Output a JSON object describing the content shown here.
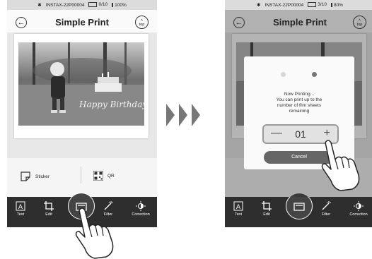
{
  "left": {
    "status": {
      "device": "INSTAX-22P00004",
      "prints": "0/10",
      "battery": "100%"
    },
    "title": "Simple Print",
    "top_label": "top",
    "photo_caption": "Happy Birthday",
    "options": [
      {
        "label": "Sticker"
      },
      {
        "label": "QR"
      }
    ],
    "tools": [
      {
        "label": "Text"
      },
      {
        "label": "Edit"
      },
      {
        "label": "Filter"
      },
      {
        "label": "Correction"
      }
    ]
  },
  "right": {
    "status": {
      "device": "INSTAX-22P00004",
      "prints": "3/10",
      "battery": "80%"
    },
    "title": "Simple Print",
    "top_label": "top",
    "dialog": {
      "line1": "Now Printing...",
      "line2": "You can print up to the",
      "line3": "number of film sheets",
      "line4": "remaining",
      "count": "01",
      "minus": "—",
      "plus": "+",
      "cancel": "Cancel"
    },
    "tools": [
      {
        "label": "Text"
      },
      {
        "label": "Edit"
      },
      {
        "label": "Filter"
      },
      {
        "label": "Correction"
      }
    ]
  }
}
